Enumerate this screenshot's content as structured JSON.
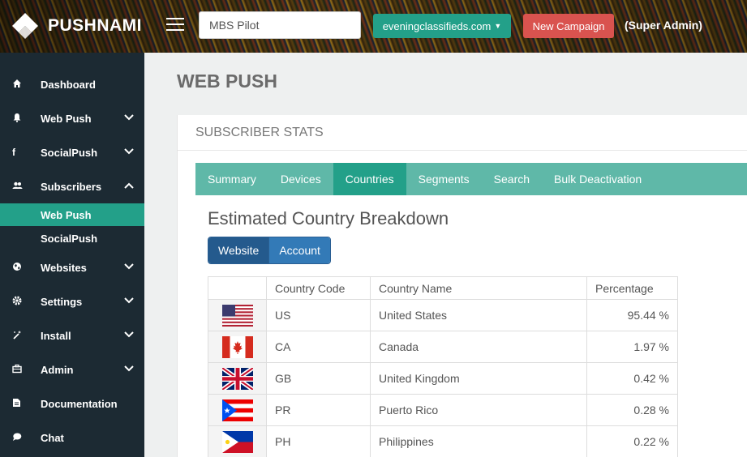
{
  "brand": {
    "name": "PUSHNAMI"
  },
  "header": {
    "search_value": "MBS Pilot",
    "site_selector": "eveningclassifieds.com",
    "new_campaign_label": "New Campaign",
    "role_label": "(Super Admin)"
  },
  "sidebar": {
    "items": [
      {
        "label": "Dashboard",
        "icon": "home-icon",
        "chevron": "none"
      },
      {
        "label": "Web Push",
        "icon": "bell-icon",
        "chevron": "down"
      },
      {
        "label": "SocialPush",
        "icon": "facebook-icon",
        "chevron": "down"
      },
      {
        "label": "Subscribers",
        "icon": "users-icon",
        "chevron": "up"
      },
      {
        "label": "Websites",
        "icon": "globe-icon",
        "chevron": "down"
      },
      {
        "label": "Settings",
        "icon": "gear-icon",
        "chevron": "down"
      },
      {
        "label": "Install",
        "icon": "wand-icon",
        "chevron": "down"
      },
      {
        "label": "Admin",
        "icon": "briefcase-icon",
        "chevron": "down"
      },
      {
        "label": "Documentation",
        "icon": "document-icon",
        "chevron": "none"
      },
      {
        "label": "Chat",
        "icon": "chat-icon",
        "chevron": "none"
      }
    ],
    "subitems": [
      {
        "label": "Web Push",
        "active": true
      },
      {
        "label": "SocialPush",
        "active": false
      }
    ]
  },
  "page": {
    "title": "WEB PUSH"
  },
  "panel": {
    "heading": "SUBSCRIBER STATS"
  },
  "tabs": [
    {
      "label": "Summary",
      "active": false
    },
    {
      "label": "Devices",
      "active": false
    },
    {
      "label": "Countries",
      "active": true
    },
    {
      "label": "Segments",
      "active": false
    },
    {
      "label": "Search",
      "active": false
    },
    {
      "label": "Bulk Deactivation",
      "active": false
    }
  ],
  "breakdown": {
    "title": "Estimated Country Breakdown",
    "toggle": {
      "website": "Website",
      "account": "Account",
      "selected": "Website"
    },
    "columns": [
      "",
      "Country Code",
      "Country Name",
      "Percentage"
    ],
    "rows": [
      {
        "flag": "us-flag-icon",
        "code": "US",
        "name": "United States",
        "pct": "95.44 %"
      },
      {
        "flag": "ca-flag-icon",
        "code": "CA",
        "name": "Canada",
        "pct": "1.97 %"
      },
      {
        "flag": "gb-flag-icon",
        "code": "GB",
        "name": "United Kingdom",
        "pct": "0.42 %"
      },
      {
        "flag": "pr-flag-icon",
        "code": "PR",
        "name": "Puerto Rico",
        "pct": "0.28 %"
      },
      {
        "flag": "ph-flag-icon",
        "code": "PH",
        "name": "Philippines",
        "pct": "0.22 %"
      }
    ]
  },
  "colors": {
    "sidebar_bg": "#1c2a33",
    "accent_teal": "#23a089",
    "tab_bar": "#5fb8a8",
    "danger": "#d9534f",
    "primary": "#337ab7"
  }
}
